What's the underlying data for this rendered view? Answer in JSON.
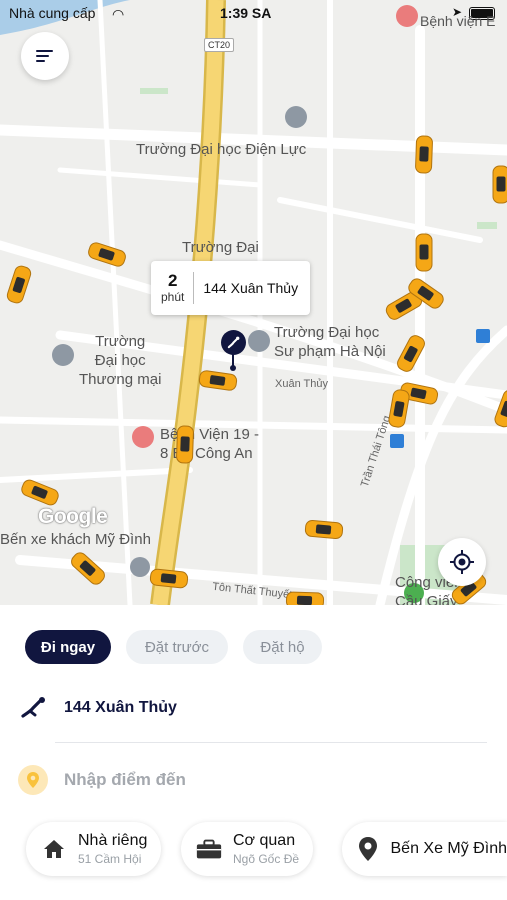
{
  "status_bar": {
    "carrier": "Nhà cung cấp",
    "time": "1:39 SA"
  },
  "map": {
    "road_shield": "CT20",
    "labels": {
      "benh_vien_top": "Bệnh viện E",
      "dh_dien_luc": "Trường Đại học Điện Lực",
      "truong_dai": "Trường Đại",
      "dh_thuong_mai": "Trường\nĐại học\nThương mại",
      "dh_su_pham": "Trường Đại học\nSư phạm Hà Nội",
      "xuan_thuy": "Xuân Thủy",
      "benh_vien_19": "Bệnh Viện 19 -\n8 Bộ Công An",
      "ben_xe": "Bến xe khách Mỹ Đình",
      "tran_thai_tong": "Trần Thái Tông",
      "ton_that_thuyet": "Tôn Thất Thuyết",
      "cong_vien": "Công viên\nCầu Giấy",
      "google": "Google"
    },
    "pickup_bubble": {
      "minutes": "2",
      "unit": "phút",
      "address": "144 Xuân Thủy"
    },
    "menu_icon": "menu-lines-icon",
    "locate_icon": "locate-target-icon"
  },
  "booking": {
    "tabs": [
      {
        "label": "Đi ngay",
        "active": true
      },
      {
        "label": "Đặt trước",
        "active": false
      },
      {
        "label": "Đặt hộ",
        "active": false
      }
    ],
    "pickup": {
      "icon": "walking-person-icon",
      "address": "144 Xuân Thủy"
    },
    "destination": {
      "icon": "location-pin-icon",
      "placeholder": "Nhập điểm đến"
    },
    "saved_places": [
      {
        "icon": "home-icon",
        "title": "Nhà riêng",
        "subtitle": "51 Cầm Hội"
      },
      {
        "icon": "briefcase-icon",
        "title": "Cơ quan",
        "subtitle": "Ngõ Gốc Đề"
      },
      {
        "icon": "map-pin-icon",
        "title": "Bến Xe Mỹ Đình",
        "subtitle": ""
      }
    ]
  },
  "colors": {
    "navy": "#11163f",
    "taxi": "#f5a716",
    "accent_yellow": "#f9c23c",
    "inactive_tab": "#eef1f4"
  }
}
